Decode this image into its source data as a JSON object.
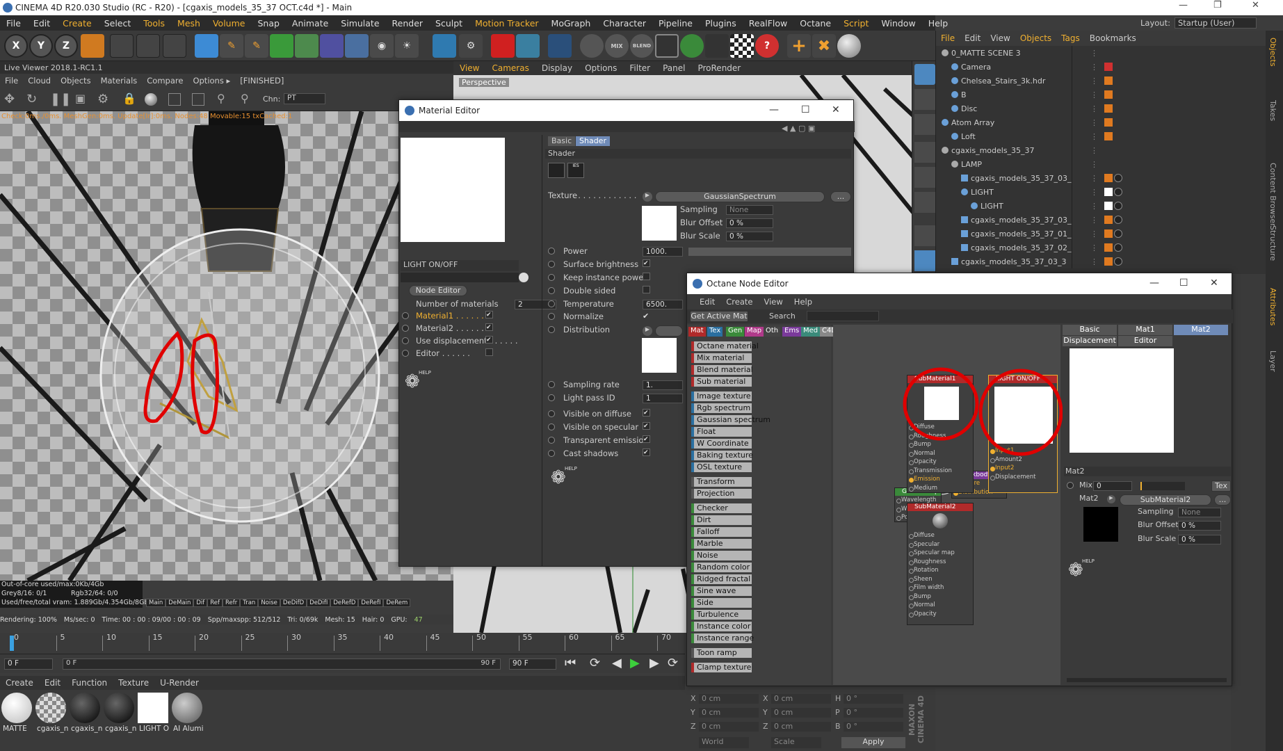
{
  "window": {
    "title": "CINEMA 4D R20.030 Studio (RC - R20) - [cgaxis_models_35_37 OCT.c4d *] - Main"
  },
  "menubar": [
    "File",
    "Edit",
    "Create",
    "Select",
    "Tools",
    "Mesh",
    "Volume",
    "Snap",
    "Animate",
    "Simulate",
    "Render",
    "Sculpt",
    "Motion Tracker",
    "MoGraph",
    "Character",
    "Pipeline",
    "Plugins",
    "RealFlow",
    "Octane",
    "Script",
    "Window",
    "Help"
  ],
  "layout": {
    "label": "Layout:",
    "value": "Startup (User)"
  },
  "live_viewer": {
    "title": "Live Viewer 2018.1-RC1.1",
    "menu": [
      "File",
      "Cloud",
      "Objects",
      "Materials",
      "Compare",
      "Options ▸",
      "[FINISHED]"
    ],
    "chn_label": "Chn:",
    "chn_value": "PT",
    "status_line": "Check:0ms./0ms. MeshGen:0ms. Update[Ir]:0ms. Nodes:48 Movable:15 txCached:1",
    "stats": [
      "Out-of-core used/max:0Kb/4Gb",
      "Grey8/16: 0/1",
      "Rgb32/64: 0/0",
      "Used/free/total vram: 1.889Gb/4.354Gb/8Gb"
    ],
    "passes": [
      "Main",
      "DeMain",
      "Dif",
      "Ref",
      "Refr",
      "Tran",
      "Noise",
      "DeDifD",
      "DeDifI",
      "DeRefD",
      "DeRefI",
      "DeRem"
    ],
    "status_row": [
      "Rendering: 100%",
      "Ms/sec: 0",
      "Time: 00 : 00 : 09/00 : 00 : 09",
      "Spp/maxspp: 512/512",
      "Tri: 0/69k",
      "Mesh: 15",
      "Hair: 0",
      "GPU:",
      "47"
    ]
  },
  "timeline": {
    "ticks": [
      "0",
      "5",
      "10",
      "15",
      "20",
      "25",
      "30",
      "35",
      "40",
      "45",
      "50",
      "55",
      "60",
      "65",
      "70"
    ],
    "start": "0 F",
    "cur": "0 F",
    "end": "90 F",
    "end2": "90 F"
  },
  "material_bar": {
    "menu": [
      "Create",
      "Edit",
      "Function",
      "Texture",
      "U-Render"
    ],
    "items": [
      "MATTE",
      "cgaxis_n",
      "cgaxis_n",
      "cgaxis_n",
      "LIGHT O",
      "AI Alumi"
    ]
  },
  "viewport_menu": [
    "View",
    "Cameras",
    "Display",
    "Options",
    "Filter",
    "Panel",
    "ProRender"
  ],
  "viewport_label": "Perspective",
  "object_manager": {
    "menu": [
      "File",
      "Edit",
      "View",
      "Objects",
      "Tags",
      "Bookmarks"
    ],
    "rows": [
      "0_MATTE SCENE 3",
      "Camera",
      "Chelsea_Stairs_3k.hdr",
      "B",
      "Disc",
      "Atom Array",
      "Loft",
      "cgaxis_models_35_37",
      "LAMP",
      "cgaxis_models_35_37_03_",
      "LIGHT",
      "LIGHT",
      "cgaxis_models_35_37_03_",
      "cgaxis_models_35_37_01_",
      "cgaxis_models_35_37_02_",
      "cgaxis_models_35_37_03_3"
    ]
  },
  "material_editor": {
    "title": "Material Editor",
    "name": "LIGHT ON/OFF",
    "node_editor_btn": "Node Editor",
    "num_materials_label": "Number of materials",
    "num_materials": "2",
    "left_params": [
      {
        "label": "Material1",
        "check": "✔",
        "active": true
      },
      {
        "label": "Material2",
        "check": "✔",
        "active": false
      },
      {
        "label": "Use displacement",
        "check": "✔",
        "active": false
      },
      {
        "label": "Editor",
        "check": "",
        "active": false
      }
    ],
    "tabs": [
      "Basic",
      "Shader"
    ],
    "section": "Shader",
    "texture_label": "Texture",
    "texture_value": "GaussianSpectrum",
    "sampling_label": "Sampling",
    "sampling_value": "None",
    "blur_offset_label": "Blur Offset",
    "blur_offset": "0 %",
    "blur_scale_label": "Blur Scale",
    "blur_scale": "0 %",
    "power_label": "Power",
    "power": "1000.",
    "params": [
      {
        "label": "Surface brightness",
        "check": "✔"
      },
      {
        "label": "Keep instance power",
        "check": ""
      },
      {
        "label": "Double sided",
        "check": ""
      }
    ],
    "temperature_label": "Temperature",
    "temperature": "6500.",
    "normalize_label": "Normalize",
    "normalize_check": "✔",
    "distribution_label": "Distribution",
    "sampling_rate_label": "Sampling rate",
    "sampling_rate": "1.",
    "light_pass_label": "Light pass ID",
    "light_pass": "1",
    "vis_params": [
      {
        "label": "Visible on diffuse",
        "check": "✔"
      },
      {
        "label": "Visible on specular",
        "check": "✔"
      },
      {
        "label": "Transparent emission",
        "check": "✔"
      },
      {
        "label": "Cast shadows",
        "check": "✔"
      }
    ],
    "help": "HELP"
  },
  "node_editor": {
    "title": "Octane Node Editor",
    "menu": [
      "Edit",
      "Create",
      "View",
      "Help"
    ],
    "get_active": "Get Active Mat",
    "search_label": "Search",
    "palette_tabs": [
      "Mat",
      "Tex",
      "Gen",
      "Map",
      "Oth",
      "Ems",
      "Med",
      "C4D"
    ],
    "palette": [
      "Octane material",
      "Mix material",
      "Blend material",
      "Sub material",
      "Image texture",
      "Rgb spectrum",
      "Gaussian spectrum",
      "Float",
      "W Coordinate",
      "Baking texture",
      "OSL texture",
      "Transform",
      "Projection",
      "Checker",
      "Dirt",
      "Falloff",
      "Marble",
      "Noise",
      "Random color",
      "Ridged fractal",
      "Sine wave",
      "Side",
      "Turbulence",
      "Instance color",
      "Instance range",
      "Toon ramp",
      "Clamp texture"
    ],
    "nodes": {
      "sub1": {
        "title": "SubMaterial1",
        "pins": [
          "Diffuse",
          "Roughness",
          "Bump",
          "Normal",
          "Opacity",
          "Transmission",
          "Emission",
          "Medium"
        ]
      },
      "sub2": {
        "title": "SubMaterial2",
        "pins": [
          "Diffuse",
          "Specular",
          "Specular map",
          "Roughness",
          "Rotation",
          "Sheen",
          "Film width",
          "Bump",
          "Normal",
          "Opacity"
        ]
      },
      "mix": {
        "title": "LIGHT ON/OFF",
        "pins": [
          "Input1",
          "Amount2",
          "Input2",
          "Displacement"
        ]
      },
      "blackbody": {
        "title": "Blackbody Em",
        "pins": [
          "Texture",
          "Distribution"
        ]
      },
      "gauss": {
        "title": "GaussianSpe",
        "pins": [
          "Wavelength",
          "Width",
          "Power"
        ]
      }
    },
    "right_tabs": [
      "Basic",
      "Mat1",
      "Mat2"
    ],
    "right_tabs2": [
      "Displacement",
      "Editor"
    ],
    "right_section": "Mat2",
    "mix_label": "Mix",
    "mix_value": "0",
    "tex_btn": "Tex",
    "mat2_label": "Mat2",
    "mat2_value": "SubMaterial2",
    "sampling_label": "Sampling",
    "sampling_value": "None",
    "blur_offset_label": "Blur Offset",
    "blur_offset": "0 %",
    "blur_scale_label": "Blur Scale",
    "blur_scale": "0 %",
    "help": "HELP"
  },
  "coords": {
    "rows": [
      [
        "X",
        "0 cm",
        "X",
        "0 cm",
        "H",
        "0 °"
      ],
      [
        "Y",
        "0 cm",
        "Y",
        "0 cm",
        "P",
        "0 °"
      ],
      [
        "Z",
        "0 cm",
        "Z",
        "0 cm",
        "B",
        "0 °"
      ]
    ],
    "world": "World",
    "scale": "Scale",
    "apply": "Apply"
  },
  "side_tabs": [
    "Objects",
    "Takes",
    "Content Browser",
    "Structure",
    "Attributes",
    "Layer"
  ],
  "colors": {
    "accent": "#f0b030",
    "highlight_red": "#e00000",
    "tab_active": "#6f8bb8"
  }
}
